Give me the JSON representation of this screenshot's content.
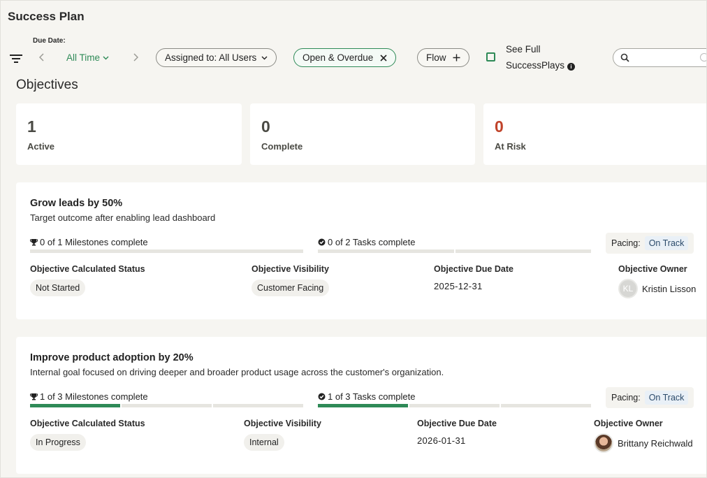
{
  "page": {
    "title": "Success Plan"
  },
  "filters": {
    "due_date_label": "Due Date:",
    "time_value": "All Time",
    "assigned_pill": "Assigned to: All Users",
    "status_pill": "Open & Overdue",
    "flow_pill": "Flow",
    "see_full_line1": "See Full",
    "see_full_line2": "SuccessPlays",
    "see_full_checked": false,
    "search_placeholder": ""
  },
  "section": {
    "title": "Objectives"
  },
  "stats": [
    {
      "value": "1",
      "label": "Active"
    },
    {
      "value": "0",
      "label": "Complete"
    },
    {
      "value": "0",
      "label": "At Risk",
      "color": "#c0432a"
    }
  ],
  "labels": {
    "calculated_status": "Objective Calculated Status",
    "visibility": "Objective Visibility",
    "due_date": "Objective Due Date",
    "owner": "Objective Owner",
    "pacing": "Pacing:"
  },
  "objectives": [
    {
      "title": "Grow leads by 50%",
      "description": "Target outcome after enabling lead dashboard",
      "milestones_text": "0 of 1 Milestones complete",
      "milestones_done": 0,
      "milestones_total": 1,
      "tasks_text": "0 of 2 Tasks complete",
      "tasks_done": 0,
      "tasks_total": 2,
      "pacing": "On Track",
      "status": "Not Started",
      "visibility": "Customer Facing",
      "due_date": "2025-12-31",
      "owner_initials": "KL",
      "owner_name": "Kristin Lisson"
    },
    {
      "title": "Improve product adoption by 20%",
      "description": "Internal goal focused on driving deeper and broader product usage across the customer's organization.",
      "milestones_text": "1 of 3 Milestones complete",
      "milestones_done": 1,
      "milestones_total": 3,
      "tasks_text": "1 of 3 Tasks complete",
      "tasks_done": 1,
      "tasks_total": 3,
      "pacing": "On Track",
      "status": "In Progress",
      "visibility": "Internal",
      "due_date": "2026-01-31",
      "owner_name": "Brittany Reichwald"
    }
  ],
  "colors": {
    "accent": "#2e8a57",
    "risk": "#c0432a"
  }
}
